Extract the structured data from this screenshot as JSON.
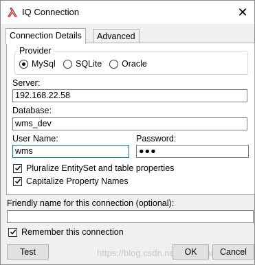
{
  "window": {
    "title": "IQ Connection",
    "close_glyph": "✕",
    "title_icon": "linqpad-lambda-icon"
  },
  "tabs": [
    {
      "label": "Connection Details",
      "active": true
    },
    {
      "label": "Advanced",
      "active": false
    }
  ],
  "provider": {
    "legend": "Provider",
    "options": [
      {
        "label": "MySql",
        "selected": true
      },
      {
        "label": "SQLite",
        "selected": false
      },
      {
        "label": "Oracle",
        "selected": false
      }
    ]
  },
  "server": {
    "label": "Server:",
    "value": "192.168.22.58"
  },
  "database": {
    "label": "Database:",
    "value": "wms_dev"
  },
  "username": {
    "label": "User Name:",
    "value": "wms"
  },
  "password": {
    "label": "Password:",
    "value": "●●●"
  },
  "options": [
    {
      "label": "Pluralize EntitySet and table properties",
      "checked": true
    },
    {
      "label": "Capitalize Property Names",
      "checked": true
    }
  ],
  "friendly_name": {
    "label": "Friendly name for this connection (optional):",
    "value": ""
  },
  "remember": {
    "label": "Remember this connection",
    "checked": true
  },
  "buttons": {
    "test": "Test",
    "ok": "OK",
    "cancel": "Cancel"
  },
  "watermark": "https://blog.csdn.net/very_chan"
}
